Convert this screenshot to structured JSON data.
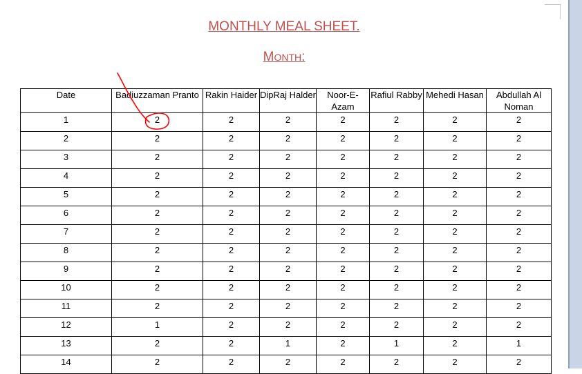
{
  "title": "MONTHLY MEAL SHEET.",
  "month_label": {
    "cap": "M",
    "rest": "ONTH",
    "colon": ":"
  },
  "table": {
    "headers": [
      "Date",
      "Badiuzzaman Pranto",
      "Rakin Haider",
      "DipRaj Halder",
      "Noor-E-Azam",
      "Rafiul Rabby",
      "Mehedi Hasan",
      "Abdullah Al Noman"
    ],
    "rows": [
      [
        "1",
        "2",
        "2",
        "2",
        "2",
        "2",
        "2",
        "2"
      ],
      [
        "2",
        "2",
        "2",
        "2",
        "2",
        "2",
        "2",
        "2"
      ],
      [
        "3",
        "2",
        "2",
        "2",
        "2",
        "2",
        "2",
        "2"
      ],
      [
        "4",
        "2",
        "2",
        "2",
        "2",
        "2",
        "2",
        "2"
      ],
      [
        "5",
        "2",
        "2",
        "2",
        "2",
        "2",
        "2",
        "2"
      ],
      [
        "6",
        "2",
        "2",
        "2",
        "2",
        "2",
        "2",
        "2"
      ],
      [
        "7",
        "2",
        "2",
        "2",
        "2",
        "2",
        "2",
        "2"
      ],
      [
        "8",
        "2",
        "2",
        "2",
        "2",
        "2",
        "2",
        "2"
      ],
      [
        "9",
        "2",
        "2",
        "2",
        "2",
        "2",
        "2",
        "2"
      ],
      [
        "10",
        "2",
        "2",
        "2",
        "2",
        "2",
        "2",
        "2"
      ],
      [
        "11",
        "2",
        "2",
        "2",
        "2",
        "2",
        "2",
        "2"
      ],
      [
        "12",
        "1",
        "2",
        "2",
        "2",
        "2",
        "2",
        "2"
      ],
      [
        "13",
        "2",
        "2",
        "1",
        "2",
        "1",
        "2",
        "1"
      ],
      [
        "14",
        "2",
        "2",
        "2",
        "2",
        "2",
        "2",
        "2"
      ]
    ]
  },
  "colors": {
    "heading": "#c0504d",
    "annotation": "#ff0000"
  }
}
